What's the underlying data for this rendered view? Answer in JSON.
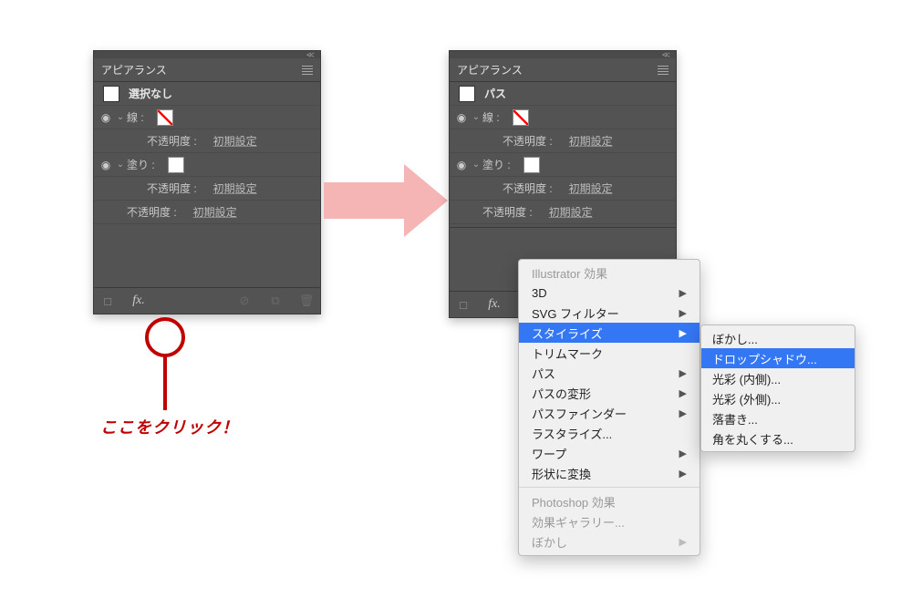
{
  "panel_title": "アピアランス",
  "left_panel": {
    "header_label": "選択なし",
    "stroke_label": "線 :",
    "fill_label": "塗り :",
    "opacity_label": "不透明度 :",
    "opacity_value": "初期設定"
  },
  "right_panel": {
    "header_label": "パス",
    "stroke_label": "線 :",
    "fill_label": "塗り :",
    "opacity_label": "不透明度 :",
    "opacity_value": "初期設定"
  },
  "callout": "ここをクリック！",
  "context_menu": {
    "section1": "Illustrator 効果",
    "items1": [
      {
        "label": "3D",
        "sub": true
      },
      {
        "label": "SVG フィルター",
        "sub": true
      },
      {
        "label": "スタイライズ",
        "sub": true,
        "sel": true
      },
      {
        "label": "トリムマーク",
        "sub": false
      },
      {
        "label": "パス",
        "sub": true
      },
      {
        "label": "パスの変形",
        "sub": true
      },
      {
        "label": "パスファインダー",
        "sub": true
      },
      {
        "label": "ラスタライズ...",
        "sub": false
      },
      {
        "label": "ワープ",
        "sub": true
      },
      {
        "label": "形状に変換",
        "sub": true
      }
    ],
    "section2": "Photoshop 効果",
    "items2": [
      {
        "label": "効果ギャラリー..."
      },
      {
        "label": "ぼかし"
      }
    ]
  },
  "submenu": {
    "items": [
      {
        "label": "ぼかし...",
        "sel": false
      },
      {
        "label": "ドロップシャドウ...",
        "sel": true
      },
      {
        "label": "光彩 (内側)...",
        "sel": false
      },
      {
        "label": "光彩 (外側)...",
        "sel": false
      },
      {
        "label": "落書き...",
        "sel": false
      },
      {
        "label": "角を丸くする...",
        "sel": false
      }
    ]
  }
}
